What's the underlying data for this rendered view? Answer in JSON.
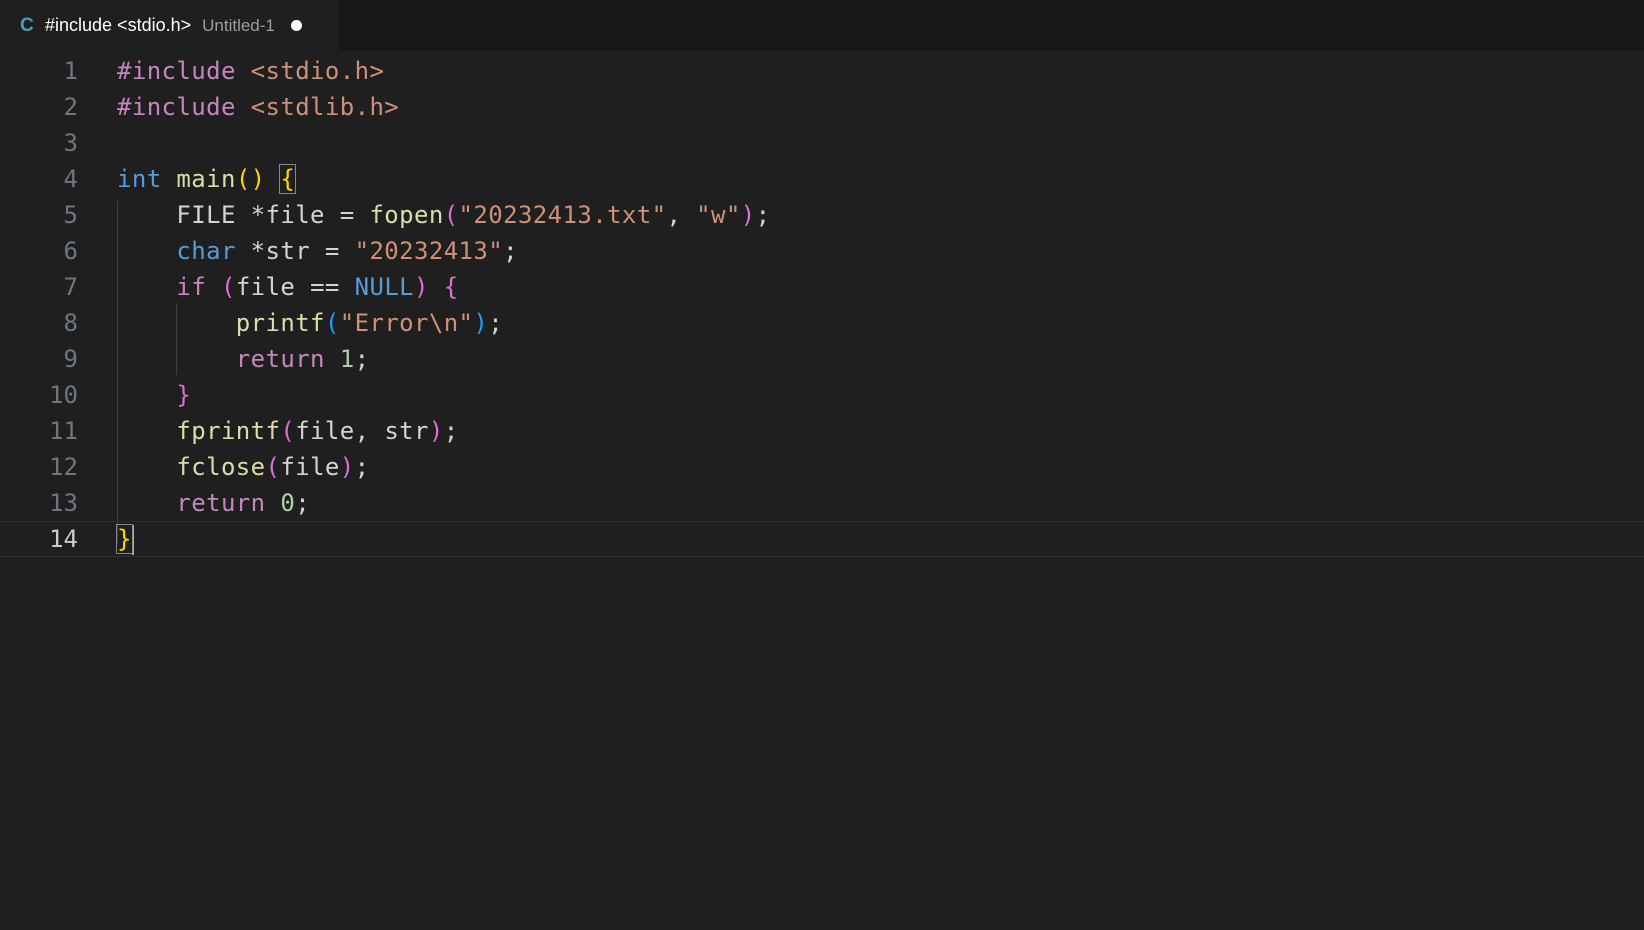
{
  "tab": {
    "language_badge": "C",
    "title": "#include <stdio.h>",
    "description": "Untitled-1"
  },
  "editor": {
    "lines": [
      {
        "number": "1",
        "tokens": [
          {
            "t": "#include",
            "c": "t-pre"
          },
          {
            "t": " ",
            "c": "t-plain"
          },
          {
            "t": "<stdio.h>",
            "c": "t-inc"
          }
        ]
      },
      {
        "number": "2",
        "tokens": [
          {
            "t": "#include",
            "c": "t-pre"
          },
          {
            "t": " ",
            "c": "t-plain"
          },
          {
            "t": "<stdlib.h>",
            "c": "t-inc"
          }
        ]
      },
      {
        "number": "3",
        "tokens": []
      },
      {
        "number": "4",
        "tokens": [
          {
            "t": "int",
            "c": "t-type"
          },
          {
            "t": " ",
            "c": "t-plain"
          },
          {
            "t": "main",
            "c": "t-func"
          },
          {
            "t": "()",
            "c": "t-b1"
          },
          {
            "t": " ",
            "c": "t-plain"
          },
          {
            "t": "{",
            "c": "t-b1 bracket-match"
          }
        ]
      },
      {
        "number": "5",
        "tokens": [
          {
            "t": "    FILE *file = ",
            "c": "t-plain"
          },
          {
            "t": "fopen",
            "c": "t-func"
          },
          {
            "t": "(",
            "c": "t-b2"
          },
          {
            "t": "\"20232413.txt\"",
            "c": "t-str"
          },
          {
            "t": ", ",
            "c": "t-plain"
          },
          {
            "t": "\"w\"",
            "c": "t-str"
          },
          {
            "t": ")",
            "c": "t-b2"
          },
          {
            "t": ";",
            "c": "t-plain"
          }
        ]
      },
      {
        "number": "6",
        "tokens": [
          {
            "t": "    ",
            "c": "t-plain"
          },
          {
            "t": "char",
            "c": "t-type"
          },
          {
            "t": " *str = ",
            "c": "t-plain"
          },
          {
            "t": "\"20232413\"",
            "c": "t-str"
          },
          {
            "t": ";",
            "c": "t-plain"
          }
        ]
      },
      {
        "number": "7",
        "tokens": [
          {
            "t": "    ",
            "c": "t-plain"
          },
          {
            "t": "if",
            "c": "t-ctrl"
          },
          {
            "t": " ",
            "c": "t-plain"
          },
          {
            "t": "(",
            "c": "t-b2"
          },
          {
            "t": "file == ",
            "c": "t-plain"
          },
          {
            "t": "NULL",
            "c": "t-const"
          },
          {
            "t": ")",
            "c": "t-b2"
          },
          {
            "t": " ",
            "c": "t-plain"
          },
          {
            "t": "{",
            "c": "t-b2"
          }
        ]
      },
      {
        "number": "8",
        "tokens": [
          {
            "t": "        ",
            "c": "t-plain"
          },
          {
            "t": "printf",
            "c": "t-func"
          },
          {
            "t": "(",
            "c": "t-b3"
          },
          {
            "t": "\"Error\\n\"",
            "c": "t-str"
          },
          {
            "t": ")",
            "c": "t-b3"
          },
          {
            "t": ";",
            "c": "t-plain"
          }
        ]
      },
      {
        "number": "9",
        "tokens": [
          {
            "t": "        ",
            "c": "t-plain"
          },
          {
            "t": "return",
            "c": "t-ctrl"
          },
          {
            "t": " ",
            "c": "t-plain"
          },
          {
            "t": "1",
            "c": "t-num"
          },
          {
            "t": ";",
            "c": "t-plain"
          }
        ]
      },
      {
        "number": "10",
        "tokens": [
          {
            "t": "    ",
            "c": "t-plain"
          },
          {
            "t": "}",
            "c": "t-b2"
          }
        ]
      },
      {
        "number": "11",
        "tokens": [
          {
            "t": "    ",
            "c": "t-plain"
          },
          {
            "t": "fprintf",
            "c": "t-func"
          },
          {
            "t": "(",
            "c": "t-b2"
          },
          {
            "t": "file, str",
            "c": "t-plain"
          },
          {
            "t": ")",
            "c": "t-b2"
          },
          {
            "t": ";",
            "c": "t-plain"
          }
        ]
      },
      {
        "number": "12",
        "tokens": [
          {
            "t": "    ",
            "c": "t-plain"
          },
          {
            "t": "fclose",
            "c": "t-func"
          },
          {
            "t": "(",
            "c": "t-b2"
          },
          {
            "t": "file",
            "c": "t-plain"
          },
          {
            "t": ")",
            "c": "t-b2"
          },
          {
            "t": ";",
            "c": "t-plain"
          }
        ]
      },
      {
        "number": "13",
        "tokens": [
          {
            "t": "    ",
            "c": "t-plain"
          },
          {
            "t": "return",
            "c": "t-ctrl"
          },
          {
            "t": " ",
            "c": "t-plain"
          },
          {
            "t": "0",
            "c": "t-num"
          },
          {
            "t": ";",
            "c": "t-plain"
          }
        ]
      },
      {
        "number": "14",
        "tokens": [
          {
            "t": "}",
            "c": "t-b1 bracket-match"
          }
        ],
        "current": true
      }
    ]
  }
}
